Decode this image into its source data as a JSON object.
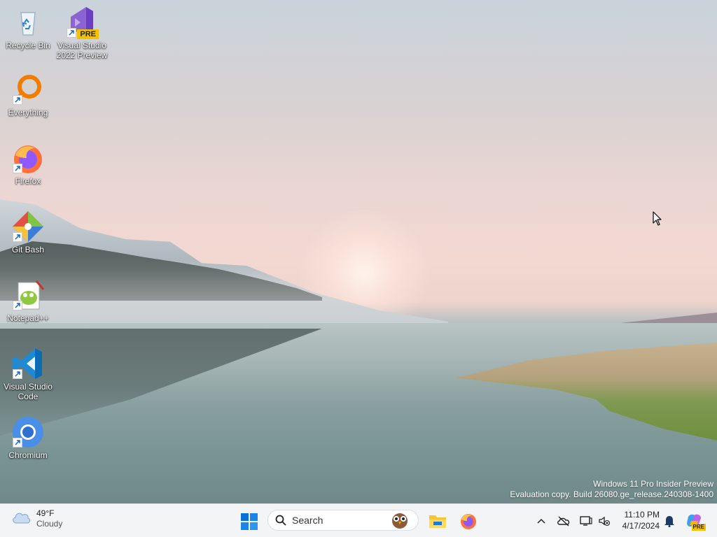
{
  "desktop": {
    "icons": [
      {
        "label": "Recycle Bin",
        "icon": "recycle-bin-icon",
        "shortcut": false
      },
      {
        "label": "Visual Studio\n2022 Preview",
        "icon": "visual-studio-icon",
        "badge": "PRE",
        "shortcut": true
      },
      {
        "label": "Everything",
        "icon": "everything-search-icon",
        "shortcut": true
      },
      {
        "label": "Firefox",
        "icon": "firefox-icon",
        "shortcut": true
      },
      {
        "label": "Git Bash",
        "icon": "git-bash-icon",
        "shortcut": true
      },
      {
        "label": "Notepad++",
        "icon": "notepad-plus-plus-icon",
        "shortcut": true
      },
      {
        "label": "Visual Studio\nCode",
        "icon": "vscode-icon",
        "shortcut": true
      },
      {
        "label": "Chromium",
        "icon": "chromium-icon",
        "shortcut": true
      }
    ],
    "watermark": {
      "line1": "Windows 11 Pro Insider Preview",
      "line2": "Evaluation copy. Build 26080.ge_release.240308-1400"
    }
  },
  "taskbar": {
    "weather": {
      "temp": "49°F",
      "condition": "Cloudy",
      "icon": "cloud-icon"
    },
    "start_icon": "windows-start-icon",
    "search": {
      "placeholder": "Search",
      "icon": "search-icon",
      "highlight_icon": "owl-icon"
    },
    "pinned": [
      {
        "name": "File Explorer",
        "icon": "file-explorer-icon"
      },
      {
        "name": "Firefox",
        "icon": "firefox-icon"
      }
    ],
    "tray": {
      "icons": [
        "chevron-up-icon",
        "onedrive-offline-icon",
        "display-icon",
        "speaker-muted-icon",
        "bell-icon",
        "copilot-icon"
      ],
      "copilot_badge": "PRE",
      "time": "11:10 PM",
      "date": "4/17/2024"
    }
  },
  "colors": {
    "taskbar_bg": "#f2f4f6",
    "accent": "#0067c0"
  }
}
